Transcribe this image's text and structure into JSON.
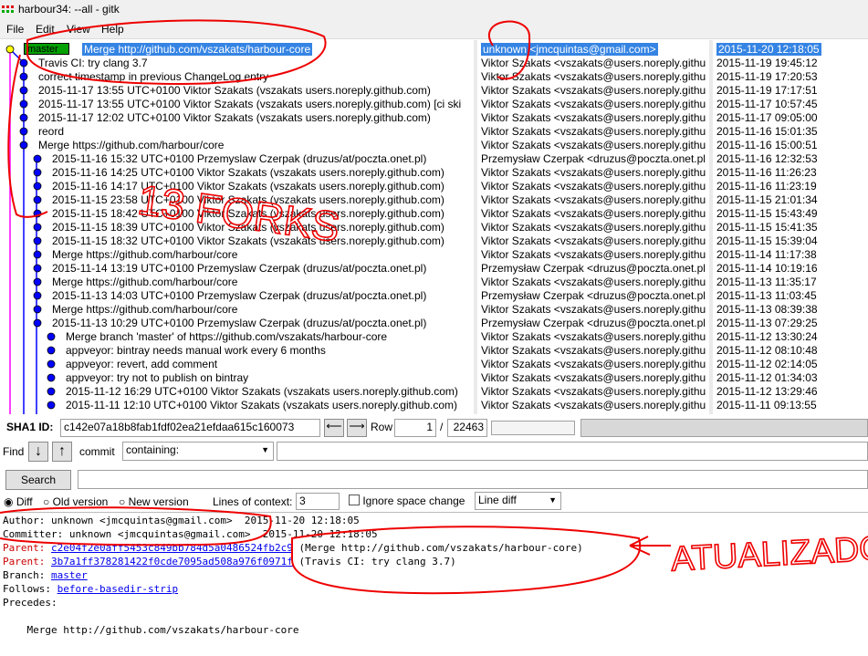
{
  "window": {
    "title": "harbour34: --all - gitk"
  },
  "menu": [
    "File",
    "Edit",
    "View",
    "Help"
  ],
  "head_branch": "master",
  "commits": [
    {
      "subject": "Merge http://github.com/vszakats/harbour-core",
      "author": "unknown <jmcquintas@gmail.com>",
      "date": "2015-11-20 12:18:05"
    },
    {
      "subject": "Travis CI: try clang 3.7",
      "author": "Viktor Szakats <vszakats@users.noreply.githu",
      "date": "2015-11-19 19:45:12"
    },
    {
      "subject": "correct timestamp in previous ChangeLog entry",
      "author": "Viktor Szakats <vszakats@users.noreply.githu",
      "date": "2015-11-19 17:20:53"
    },
    {
      "subject": "2015-11-17 13:55 UTC+0100 Viktor Szakats (vszakats users.noreply.github.com)",
      "author": "Viktor Szakats <vszakats@users.noreply.githu",
      "date": "2015-11-19 17:17:51"
    },
    {
      "subject": "2015-11-17 13:55 UTC+0100 Viktor Szakats (vszakats users.noreply.github.com) [ci ski",
      "author": "Viktor Szakats <vszakats@users.noreply.githu",
      "date": "2015-11-17 10:57:45"
    },
    {
      "subject": "2015-11-17 12:02 UTC+0100 Viktor Szakats (vszakats users.noreply.github.com)",
      "author": "Viktor Szakats <vszakats@users.noreply.githu",
      "date": "2015-11-17 09:05:00"
    },
    {
      "subject": "reord",
      "author": "Viktor Szakats <vszakats@users.noreply.githu",
      "date": "2015-11-16 15:01:35"
    },
    {
      "subject": "Merge https://github.com/harbour/core",
      "author": "Viktor Szakats <vszakats@users.noreply.githu",
      "date": "2015-11-16 15:00:51"
    },
    {
      "subject": "2015-11-16 15:32 UTC+0100 Przemyslaw Czerpak (druzus/at/poczta.onet.pl)",
      "author": "Przemysław Czerpak <druzus@poczta.onet.pl",
      "date": "2015-11-16 12:32:53"
    },
    {
      "subject": "2015-11-16 14:25 UTC+0100 Viktor Szakats (vszakats users.noreply.github.com)",
      "author": "Viktor Szakats <vszakats@users.noreply.githu",
      "date": "2015-11-16 11:26:23"
    },
    {
      "subject": "2015-11-16 14:17 UTC+0100 Viktor Szakats (vszakats users.noreply.github.com)",
      "author": "Viktor Szakats <vszakats@users.noreply.githu",
      "date": "2015-11-16 11:23:19"
    },
    {
      "subject": "2015-11-15 23:58 UTC+0100 Viktor Szakats (vszakats users.noreply.github.com)",
      "author": "Viktor Szakats <vszakats@users.noreply.githu",
      "date": "2015-11-15 21:01:34"
    },
    {
      "subject": "2015-11-15 18:42 UTC+0100 Viktor Szakats (vszakats users.noreply.github.com)",
      "author": "Viktor Szakats <vszakats@users.noreply.githu",
      "date": "2015-11-15 15:43:49"
    },
    {
      "subject": "2015-11-15 18:39 UTC+0100 Viktor Szakats (vszakats users.noreply.github.com)",
      "author": "Viktor Szakats <vszakats@users.noreply.githu",
      "date": "2015-11-15 15:41:35"
    },
    {
      "subject": "2015-11-15 18:32 UTC+0100 Viktor Szakats (vszakats users.noreply.github.com)",
      "author": "Viktor Szakats <vszakats@users.noreply.githu",
      "date": "2015-11-15 15:39:04"
    },
    {
      "subject": "Merge https://github.com/harbour/core",
      "author": "Viktor Szakats <vszakats@users.noreply.githu",
      "date": "2015-11-14 11:17:38"
    },
    {
      "subject": "2015-11-14 13:19 UTC+0100 Przemyslaw Czerpak (druzus/at/poczta.onet.pl)",
      "author": "Przemysław Czerpak <druzus@poczta.onet.pl",
      "date": "2015-11-14 10:19:16"
    },
    {
      "subject": "Merge https://github.com/harbour/core",
      "author": "Viktor Szakats <vszakats@users.noreply.githu",
      "date": "2015-11-13 11:35:17"
    },
    {
      "subject": "2015-11-13 14:03 UTC+0100 Przemyslaw Czerpak (druzus/at/poczta.onet.pl)",
      "author": "Przemysław Czerpak <druzus@poczta.onet.pl",
      "date": "2015-11-13 11:03:45"
    },
    {
      "subject": "Merge https://github.com/harbour/core",
      "author": "Viktor Szakats <vszakats@users.noreply.githu",
      "date": "2015-11-13 08:39:38"
    },
    {
      "subject": "2015-11-13 10:29 UTC+0100 Przemyslaw Czerpak (druzus/at/poczta.onet.pl)",
      "author": "Przemysław Czerpak <druzus@poczta.onet.pl",
      "date": "2015-11-13 07:29:25"
    },
    {
      "subject": "Merge branch 'master' of https://github.com/vszakats/harbour-core",
      "author": "Viktor Szakats <vszakats@users.noreply.githu",
      "date": "2015-11-12 13:30:24"
    },
    {
      "subject": "appveyor: bintray needs manual work every 6 months",
      "author": "Viktor Szakats <vszakats@users.noreply.githu",
      "date": "2015-11-12 08:10:48"
    },
    {
      "subject": "appveyor: revert, add comment",
      "author": "Viktor Szakats <vszakats@users.noreply.githu",
      "date": "2015-11-12 02:14:05"
    },
    {
      "subject": "appveyor: try not to publish on bintray",
      "author": "Viktor Szakats <vszakats@users.noreply.githu",
      "date": "2015-11-12 01:34:03"
    },
    {
      "subject": "2015-11-12 16:29 UTC+0100 Viktor Szakats (vszakats users.noreply.github.com)",
      "author": "Viktor Szakats <vszakats@users.noreply.githu",
      "date": "2015-11-12 13:29:46"
    },
    {
      "subject": "2015-11-11 12:10 UTC+0100 Viktor Szakats (vszakats users.noreply.github.com)",
      "author": "Viktor Szakats <vszakats@users.noreply.githu",
      "date": "2015-11-11 09:13:55"
    }
  ],
  "sha1": {
    "label": "SHA1 ID:",
    "value": "c142e07a18b8fab1fdf02ea21efdaa615c160073"
  },
  "row": {
    "label": "Row",
    "current": "1",
    "sep": "/",
    "total": "22463"
  },
  "find": {
    "label": "Find",
    "commit_label": "commit",
    "mode": "containing:",
    "search_button": "Search"
  },
  "diff_opts": {
    "diff": "Diff",
    "old": "Old version",
    "new": "New version",
    "context_label": "Lines of context:",
    "context_value": "3",
    "ignore_space": "Ignore space change",
    "diff_mode": "Line diff"
  },
  "details": {
    "author": "Author: unknown <jmcquintas@gmail.com>  2015-11-20 12:18:05",
    "committer": "Committer: unknown <jmcquintas@gmail.com>  2015-11-20 12:18:05",
    "parent1_label": "Parent: ",
    "parent1_hash": "c2e04f2e0aff5453c849bb784d5a0486524fb2c9",
    "parent1_desc": " (Merge http://github.com/vszakats/harbour-core)",
    "parent2_label": "Parent: ",
    "parent2_hash": "3b7a1ff378281422f0cde7095ad508a976f0971f",
    "parent2_desc": " (Travis CI: try clang 3.7)",
    "branch_label": "Branch: ",
    "branch": "master",
    "follows_label": "Follows: ",
    "follows": "before-basedir-strip",
    "precedes_label": "Precedes:",
    "message": "    Merge http://github.com/vszakats/harbour-core"
  },
  "annotations": {
    "forks_text": "13 FORKS",
    "update_text": "ATUALIZADO"
  },
  "colors": {
    "selection": "#3584e4",
    "graph_blue": "#0000ff",
    "graph_magenta": "#ff00ff",
    "annotation_red": "#ee0000",
    "head_green": "#00a000"
  }
}
